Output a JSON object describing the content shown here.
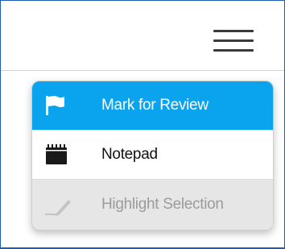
{
  "topbar": {
    "menu_icon": "hamburger-menu-icon"
  },
  "menu": {
    "items": [
      {
        "label": "Mark for Review",
        "icon": "flag-icon",
        "state": "active"
      },
      {
        "label": "Notepad",
        "icon": "notepad-icon",
        "state": "normal"
      },
      {
        "label": "Highlight Selection",
        "icon": "highlighter-icon",
        "state": "disabled"
      }
    ]
  },
  "colors": {
    "frame_border": "#1a5fb4",
    "active_bg": "#0aa4ee",
    "disabled_bg": "#e6e6e6",
    "disabled_text": "#9b9b9b"
  }
}
